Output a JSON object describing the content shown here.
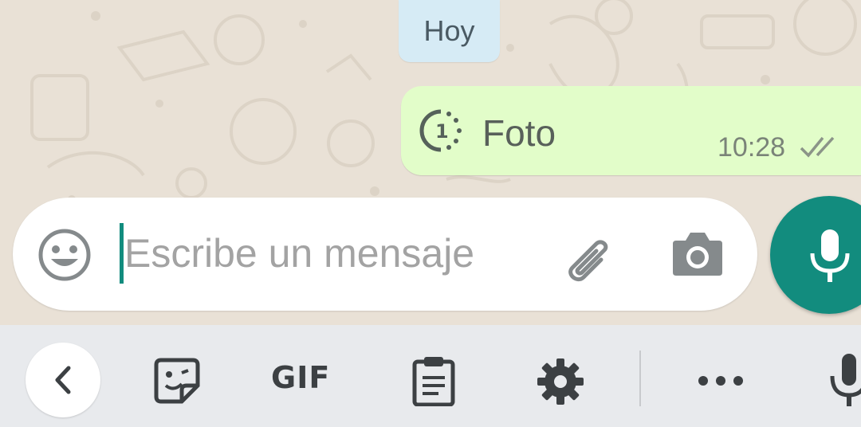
{
  "chat": {
    "date_label": "Hoy",
    "message": {
      "text": "Foto",
      "time": "10:28",
      "status_icon": "double-check-icon",
      "type_icon": "view-once-icon"
    }
  },
  "composer": {
    "placeholder": "Escribe un mensaje",
    "value": "",
    "emoji_icon": "emoji-icon",
    "attach_icon": "paperclip-icon",
    "camera_icon": "camera-icon",
    "send_icon": "microphone-icon"
  },
  "keyboard_toolbar": {
    "items": [
      "back-icon",
      "sticker-icon",
      "GIF",
      "clipboard-icon",
      "gear-icon",
      "more-icon",
      "microphone-icon"
    ],
    "gif_label": "GIF"
  },
  "colors": {
    "accent": "#128c7e",
    "outgoing_bubble": "#e2fdc9",
    "date_chip": "#d6ebf5",
    "chat_background": "#e9e1d6",
    "keyboard_bar": "#e8eaed"
  }
}
